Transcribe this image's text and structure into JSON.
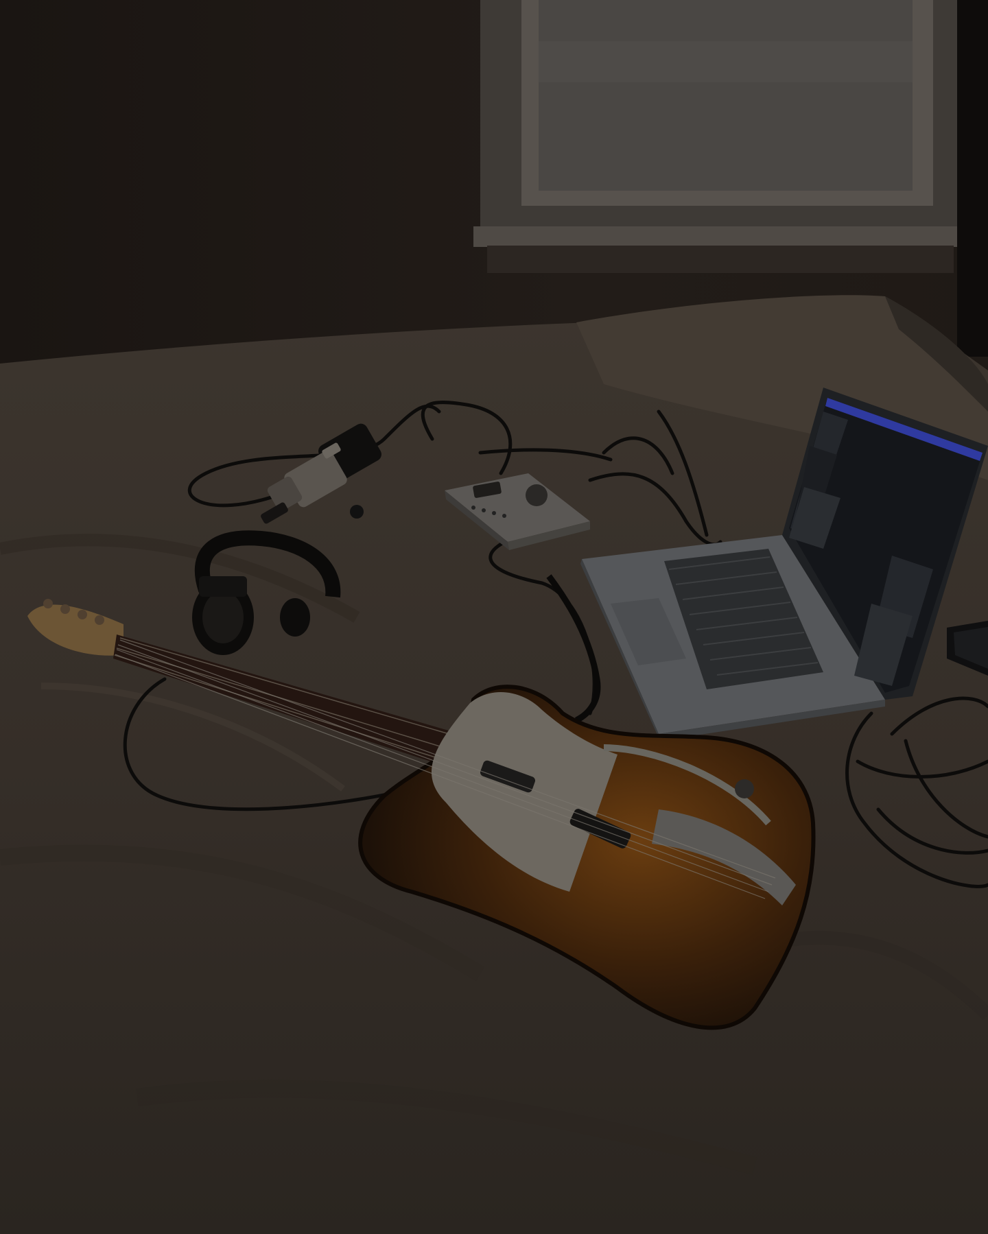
{
  "photo": {
    "palette": {
      "wall": "#201a16",
      "window_glass": "#4a4744",
      "window_frame": "#57524d",
      "bedding": "#3a332c",
      "bedding_highlight": "#4a423a",
      "guitar_sunburst_edge": "#1d1108",
      "guitar_sunburst_center": "#6a3d10",
      "pickguard": "#6d6860",
      "fretboard": "#231510",
      "laptop_body": "#55575a",
      "laptop_screen": "#14161a",
      "screen_accent": "#2f3aa0",
      "interface_body": "#5a5754",
      "cable": "#0c0b0a"
    },
    "objects": [
      "window",
      "bed-with-white-sheets",
      "electric-guitar",
      "laptop-with-daw",
      "audio-interface",
      "microphone",
      "headphones",
      "phone",
      "cables"
    ]
  }
}
